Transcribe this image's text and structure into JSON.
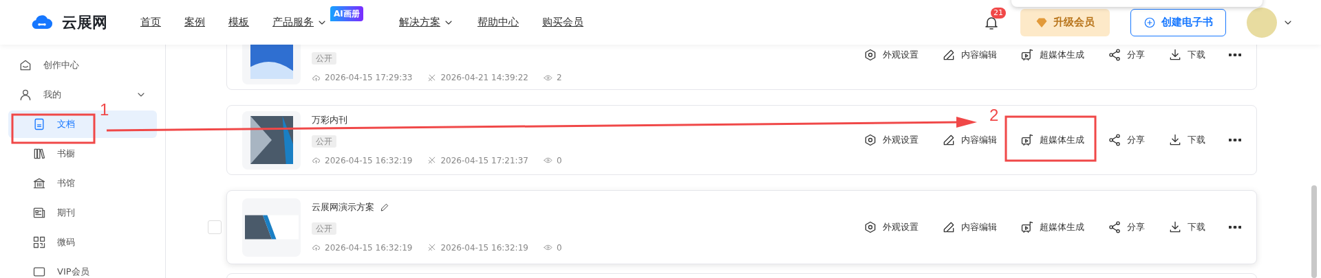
{
  "header": {
    "logo": "云展网",
    "nav": [
      {
        "label": "首页",
        "dropdown": false
      },
      {
        "label": "案例",
        "dropdown": false
      },
      {
        "label": "模板",
        "dropdown": false
      },
      {
        "label": "产品服务",
        "dropdown": true,
        "badge": "AI画册"
      },
      {
        "label": "解决方案",
        "dropdown": true
      },
      {
        "label": "帮助中心",
        "dropdown": false
      },
      {
        "label": "购买会员",
        "dropdown": false
      }
    ],
    "notifications": "21",
    "upgrade_button": "升级会员",
    "create_button": "创建电子书"
  },
  "sidebar": {
    "items": [
      {
        "label": "创作中心",
        "selected": false
      },
      {
        "label": "我的",
        "expanded": true,
        "children": [
          {
            "label": "文档",
            "selected": true
          },
          {
            "label": "书橱",
            "selected": false
          },
          {
            "label": "书馆",
            "selected": false
          },
          {
            "label": "期刊",
            "selected": false
          },
          {
            "label": "微码",
            "selected": false
          },
          {
            "label": "VIP会员",
            "selected": false
          }
        ]
      }
    ]
  },
  "documents": [
    {
      "hovered": false,
      "visibility": "公开",
      "uploaded": "2026-04-15 17:29:33",
      "modified": "2026-04-21 14:39:22",
      "views": "2",
      "actions": [
        "外观设置",
        "内容编辑",
        "超媒体生成",
        "分享",
        "下载"
      ]
    },
    {
      "title": "万彩内刊",
      "hovered": false,
      "visibility": "公开",
      "uploaded": "2026-04-15 16:32:19",
      "modified": "2026-04-15 17:21:37",
      "views": "0",
      "actions": [
        "外观设置",
        "内容编辑",
        "超媒体生成",
        "分享",
        "下载"
      ]
    },
    {
      "title": "云展网演示方案",
      "hovered": true,
      "visibility": "公开",
      "uploaded": "2026-04-15 16:32:19",
      "modified": "2026-04-15 16:32:19",
      "views": "0",
      "actions": [
        "外观设置",
        "内容编辑",
        "超媒体生成",
        "分享",
        "下载"
      ]
    }
  ],
  "annotations": [
    {
      "label": "1"
    },
    {
      "label": "2"
    }
  ]
}
